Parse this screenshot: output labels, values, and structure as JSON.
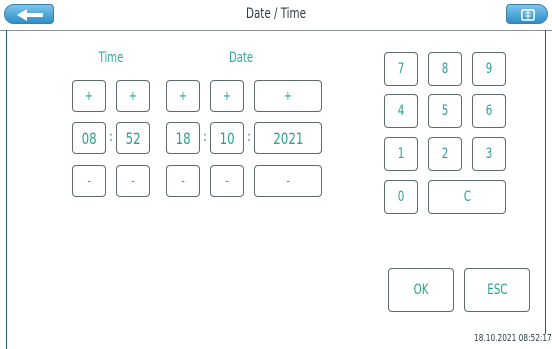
{
  "header": {
    "title": "Date / Time"
  },
  "labels": {
    "time": "Time",
    "date": "Date"
  },
  "controls": {
    "plus": "+",
    "minus": "-",
    "separator": ":"
  },
  "values": {
    "hour": "08",
    "minute": "52",
    "day": "18",
    "month": "10",
    "year": "2021"
  },
  "keypad": {
    "k7": "7",
    "k8": "8",
    "k9": "9",
    "k4": "4",
    "k5": "5",
    "k6": "6",
    "k1": "1",
    "k2": "2",
    "k3": "3",
    "k0": "0",
    "clear": "C"
  },
  "actions": {
    "ok": "OK",
    "esc": "ESC"
  },
  "status": {
    "datetime": "18.10.2021 08:52:17"
  },
  "icons": {
    "back": "back-arrow-icon",
    "keyboard": "keyboard-icon"
  },
  "colors": {
    "accent_text": "#2aa090",
    "header_button": "#2d8fc8",
    "border": "#5d6a72"
  }
}
